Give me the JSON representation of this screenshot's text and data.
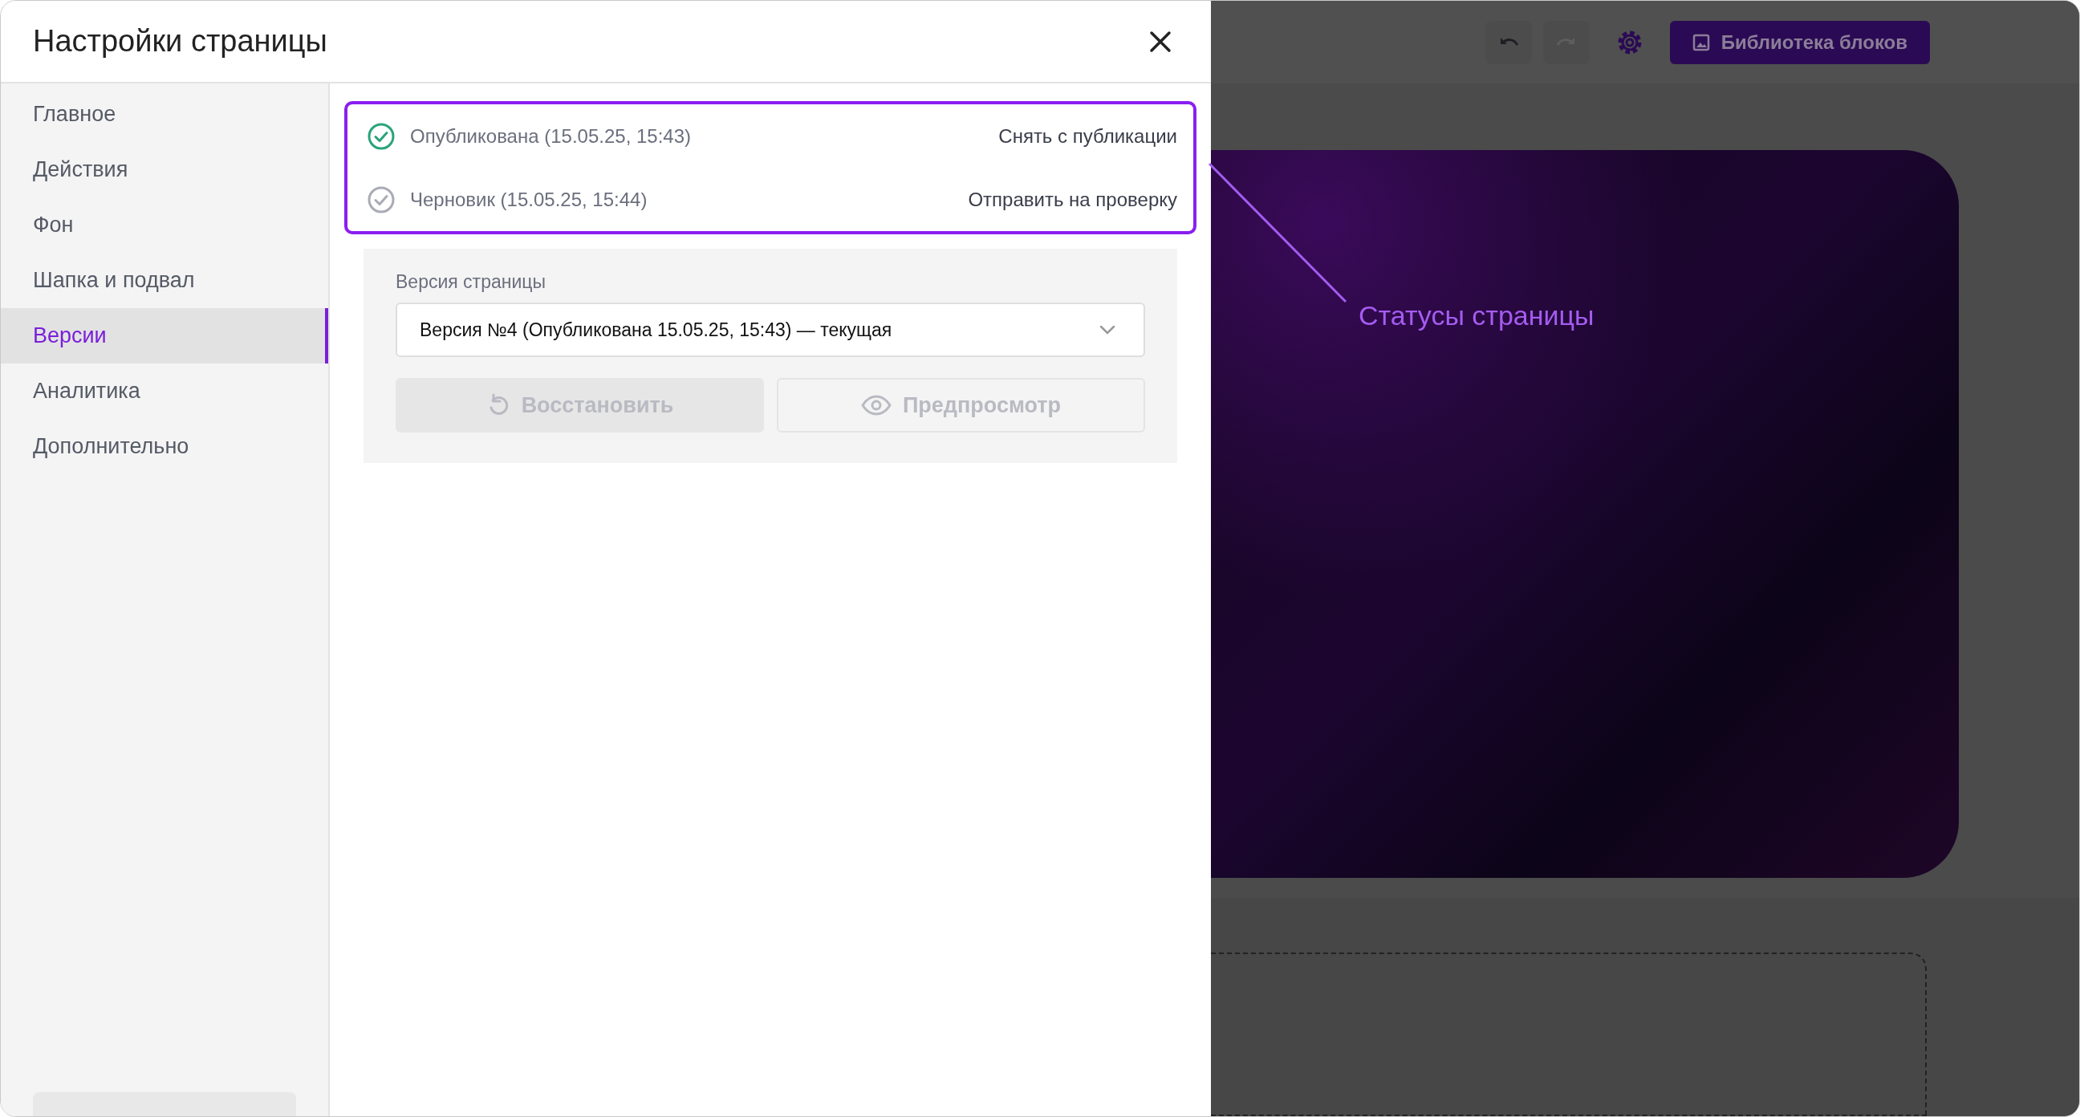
{
  "dialog": {
    "title": "Настройки страницы"
  },
  "sidebar": {
    "items": [
      {
        "label": "Главное",
        "selected": false
      },
      {
        "label": "Действия",
        "selected": false
      },
      {
        "label": "Фон",
        "selected": false
      },
      {
        "label": "Шапка и подвал",
        "selected": false
      },
      {
        "label": "Версии",
        "selected": true
      },
      {
        "label": "Аналитика",
        "selected": false
      },
      {
        "label": "Дополнительно",
        "selected": false
      }
    ]
  },
  "statuses": [
    {
      "kind": "published",
      "text": "Опубликована (15.05.25, 15:43)",
      "action": "Снять с публикации"
    },
    {
      "kind": "draft",
      "text": "Черновик (15.05.25, 15:44)",
      "action": "Отправить на проверку"
    }
  ],
  "version": {
    "label": "Версия страницы",
    "value": "Версия №4 (Опубликована 15.05.25, 15:43) — текущая",
    "buttons": [
      {
        "kind": "restore",
        "label": "Восстановить",
        "disabled": true
      },
      {
        "kind": "preview",
        "label": "Предпросмотр",
        "disabled": true
      }
    ]
  },
  "toolbar": {
    "undo_disabled": false,
    "redo_disabled": true,
    "library_button": "Библиотека блоков"
  },
  "annotation": "Статусы страницы"
}
